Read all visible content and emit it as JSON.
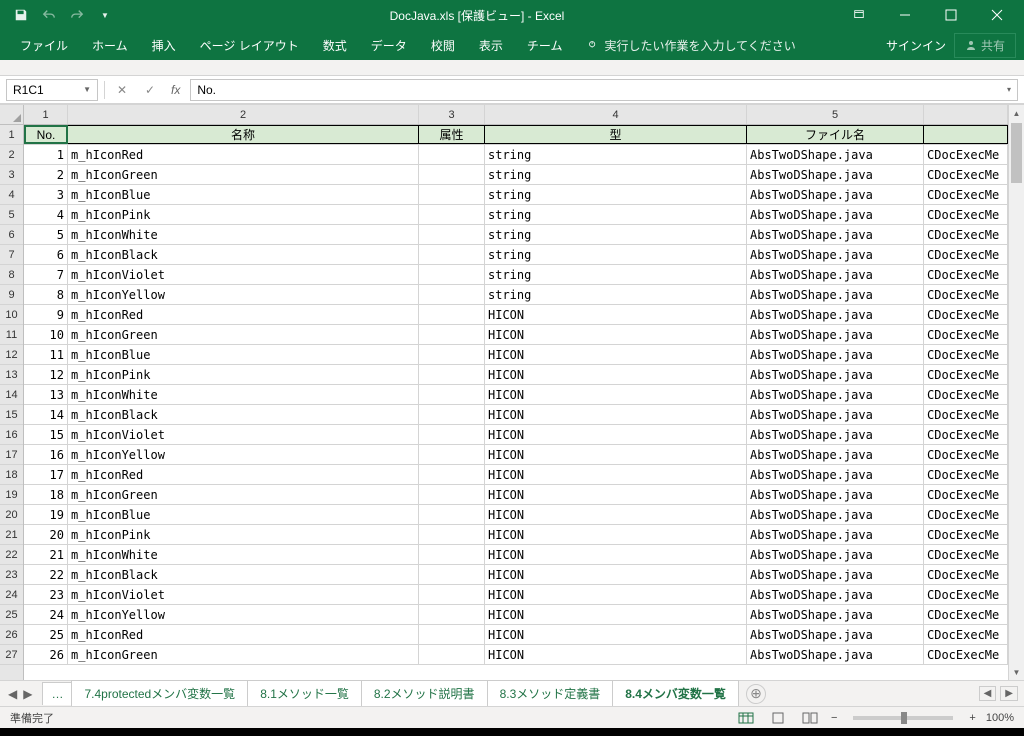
{
  "title": "DocJava.xls  [保護ビュー] - Excel",
  "qat": {
    "save": "保存",
    "undo": "元に戻す",
    "redo": "やり直し",
    "custom": "▼"
  },
  "ribbon": {
    "tabs": [
      "ファイル",
      "ホーム",
      "挿入",
      "ページ レイアウト",
      "数式",
      "データ",
      "校閲",
      "表示",
      "チーム"
    ],
    "tellme": "実行したい作業を入力してください",
    "signin": "サインイン",
    "share": "共有"
  },
  "namebox": "R1C1",
  "formula": "No.",
  "columns": [
    {
      "n": "1",
      "w": "cw1"
    },
    {
      "n": "2",
      "w": "cw2"
    },
    {
      "n": "3",
      "w": "cw3"
    },
    {
      "n": "4",
      "w": "cw4"
    },
    {
      "n": "5",
      "w": "cw5"
    },
    {
      "n": "",
      "w": "cw6"
    }
  ],
  "headers": [
    "No.",
    "名称",
    "属性",
    "型",
    "ファイル名",
    ""
  ],
  "rows": [
    {
      "no": "1",
      "name": "m_hIconRed",
      "attr": "",
      "type": "string",
      "file": "AbsTwoDShape.java",
      "extra": "CDocExecMe"
    },
    {
      "no": "2",
      "name": "m_hIconGreen",
      "attr": "",
      "type": "string",
      "file": "AbsTwoDShape.java",
      "extra": "CDocExecMe"
    },
    {
      "no": "3",
      "name": "m_hIconBlue",
      "attr": "",
      "type": "string",
      "file": "AbsTwoDShape.java",
      "extra": "CDocExecMe"
    },
    {
      "no": "4",
      "name": "m_hIconPink",
      "attr": "",
      "type": "string",
      "file": "AbsTwoDShape.java",
      "extra": "CDocExecMe"
    },
    {
      "no": "5",
      "name": "m_hIconWhite",
      "attr": "",
      "type": "string",
      "file": "AbsTwoDShape.java",
      "extra": "CDocExecMe"
    },
    {
      "no": "6",
      "name": "m_hIconBlack",
      "attr": "",
      "type": "string",
      "file": "AbsTwoDShape.java",
      "extra": "CDocExecMe"
    },
    {
      "no": "7",
      "name": "m_hIconViolet",
      "attr": "",
      "type": "string",
      "file": "AbsTwoDShape.java",
      "extra": "CDocExecMe"
    },
    {
      "no": "8",
      "name": "m_hIconYellow",
      "attr": "",
      "type": "string",
      "file": "AbsTwoDShape.java",
      "extra": "CDocExecMe"
    },
    {
      "no": "9",
      "name": "m_hIconRed",
      "attr": "",
      "type": "HICON",
      "file": "AbsTwoDShape.java",
      "extra": "CDocExecMe"
    },
    {
      "no": "10",
      "name": "m_hIconGreen",
      "attr": "",
      "type": "HICON",
      "file": "AbsTwoDShape.java",
      "extra": "CDocExecMe"
    },
    {
      "no": "11",
      "name": "m_hIconBlue",
      "attr": "",
      "type": "HICON",
      "file": "AbsTwoDShape.java",
      "extra": "CDocExecMe"
    },
    {
      "no": "12",
      "name": "m_hIconPink",
      "attr": "",
      "type": "HICON",
      "file": "AbsTwoDShape.java",
      "extra": "CDocExecMe"
    },
    {
      "no": "13",
      "name": "m_hIconWhite",
      "attr": "",
      "type": "HICON",
      "file": "AbsTwoDShape.java",
      "extra": "CDocExecMe"
    },
    {
      "no": "14",
      "name": "m_hIconBlack",
      "attr": "",
      "type": "HICON",
      "file": "AbsTwoDShape.java",
      "extra": "CDocExecMe"
    },
    {
      "no": "15",
      "name": "m_hIconViolet",
      "attr": "",
      "type": "HICON",
      "file": "AbsTwoDShape.java",
      "extra": "CDocExecMe"
    },
    {
      "no": "16",
      "name": "m_hIconYellow",
      "attr": "",
      "type": "HICON",
      "file": "AbsTwoDShape.java",
      "extra": "CDocExecMe"
    },
    {
      "no": "17",
      "name": "m_hIconRed",
      "attr": "",
      "type": "HICON",
      "file": "AbsTwoDShape.java",
      "extra": "CDocExecMe"
    },
    {
      "no": "18",
      "name": "m_hIconGreen",
      "attr": "",
      "type": "HICON",
      "file": "AbsTwoDShape.java",
      "extra": "CDocExecMe"
    },
    {
      "no": "19",
      "name": "m_hIconBlue",
      "attr": "",
      "type": "HICON",
      "file": "AbsTwoDShape.java",
      "extra": "CDocExecMe"
    },
    {
      "no": "20",
      "name": "m_hIconPink",
      "attr": "",
      "type": "HICON",
      "file": "AbsTwoDShape.java",
      "extra": "CDocExecMe"
    },
    {
      "no": "21",
      "name": "m_hIconWhite",
      "attr": "",
      "type": "HICON",
      "file": "AbsTwoDShape.java",
      "extra": "CDocExecMe"
    },
    {
      "no": "22",
      "name": "m_hIconBlack",
      "attr": "",
      "type": "HICON",
      "file": "AbsTwoDShape.java",
      "extra": "CDocExecMe"
    },
    {
      "no": "23",
      "name": "m_hIconViolet",
      "attr": "",
      "type": "HICON",
      "file": "AbsTwoDShape.java",
      "extra": "CDocExecMe"
    },
    {
      "no": "24",
      "name": "m_hIconYellow",
      "attr": "",
      "type": "HICON",
      "file": "AbsTwoDShape.java",
      "extra": "CDocExecMe"
    },
    {
      "no": "25",
      "name": "m_hIconRed",
      "attr": "",
      "type": "HICON",
      "file": "AbsTwoDShape.java",
      "extra": "CDocExecMe"
    },
    {
      "no": "26",
      "name": "m_hIconGreen",
      "attr": "",
      "type": "HICON",
      "file": "AbsTwoDShape.java",
      "extra": "CDocExecMe"
    }
  ],
  "sheets": {
    "dots": "…",
    "list": [
      "7.4protectedメンバ変数一覧",
      "8.1メソッド一覧",
      "8.2メソッド説明書",
      "8.3メソッド定義書",
      "8.4メンバ変数一覧"
    ],
    "active": 4
  },
  "status": {
    "ready": "準備完了",
    "zoom": "100%"
  }
}
